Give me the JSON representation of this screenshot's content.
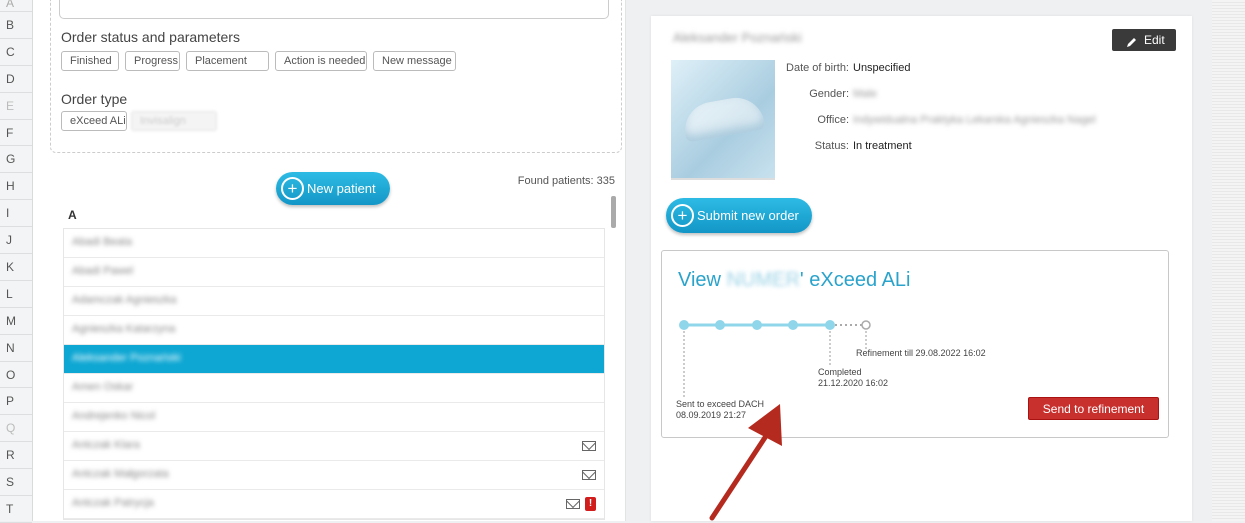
{
  "alphabet": [
    "A",
    "B",
    "C",
    "D",
    "E",
    "F",
    "G",
    "H",
    "I",
    "J",
    "K",
    "L",
    "M",
    "N",
    "O",
    "P",
    "Q",
    "R",
    "S",
    "T"
  ],
  "filters": {
    "status_title": "Order status and parameters",
    "status_chips": [
      "Finished",
      "Progress",
      "Placement",
      "Action is needed",
      "New message"
    ],
    "type_title": "Order type",
    "type_chips": [
      "eXceed ALi",
      "Invisalign"
    ]
  },
  "patients": {
    "new_button": "New patient",
    "found_text": "Found patients: 335",
    "group_letter": "A",
    "rows": [
      {
        "name": "Abadi Beata",
        "mail": false,
        "alert": false,
        "selected": false
      },
      {
        "name": "Abadi Pawel",
        "mail": false,
        "alert": false,
        "selected": false
      },
      {
        "name": "Adamczak Agnieszka",
        "mail": false,
        "alert": false,
        "selected": false
      },
      {
        "name": "Agnieszka Katarzyna",
        "mail": false,
        "alert": false,
        "selected": false
      },
      {
        "name": "Aleksander Poznański",
        "mail": false,
        "alert": false,
        "selected": true
      },
      {
        "name": "Amen Oskar",
        "mail": false,
        "alert": false,
        "selected": false
      },
      {
        "name": "Andrejenko Nicol",
        "mail": false,
        "alert": false,
        "selected": false
      },
      {
        "name": "Antczak Klara",
        "mail": true,
        "alert": false,
        "selected": false
      },
      {
        "name": "Antczak Małgorzata",
        "mail": true,
        "alert": false,
        "selected": false
      },
      {
        "name": "Antczak Patrycja",
        "mail": true,
        "alert": true,
        "selected": false
      }
    ]
  },
  "detail": {
    "patient_name": "Aleksander Poznański",
    "edit_label": "Edit",
    "info": [
      {
        "key": "Date of birth:",
        "value": "Unspecified",
        "blurred": false
      },
      {
        "key": "Gender:",
        "value": "Male",
        "blurred": true
      },
      {
        "key": "Office:",
        "value": "Indywidualna Praktyka Lekarska Agnieszka Nagel",
        "blurred": true
      },
      {
        "key": "Status:",
        "value": "In treatment",
        "blurred": false
      }
    ],
    "submit_label": "Submit new order"
  },
  "order": {
    "title_prefix": "View",
    "title_blurred": "NUMER",
    "title_suffix": "' eXceed ALi",
    "events": {
      "sent": "Sent to exceed DACH",
      "sent_date": "08.09.2019 21:27",
      "completed": "Completed",
      "completed_date": "21.12.2020 16:02",
      "refinement": "Refinement till 29.08.2022 16:02"
    },
    "refine_button": "Send to refinement"
  },
  "colors": {
    "accent": "#1aa7d4",
    "selected_row": "#0ea7d3",
    "danger": "#c8302e",
    "timeline": "#8fd6ea"
  },
  "icons": [
    "plus-circle-icon",
    "pencil-icon",
    "mail-icon",
    "alert-icon",
    "arrow-annotation-icon"
  ]
}
